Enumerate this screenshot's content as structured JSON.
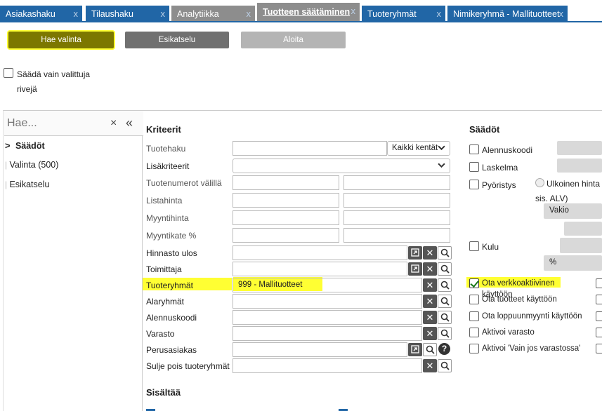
{
  "tabs": [
    {
      "label": "Asiakashaku",
      "close": "x"
    },
    {
      "label": "Tilaushaku",
      "close": "x"
    },
    {
      "label": "Analytiikka",
      "close": "x"
    },
    {
      "label": "Tuotteen säätäminen",
      "close": "x"
    },
    {
      "label": "Tuoteryhmät",
      "close": "x"
    },
    {
      "label": "Nimikeryhmä - Mallituotteet",
      "close": "x"
    }
  ],
  "toolbar": {
    "hae_label": "Hae valinta",
    "esikatselu_label": "Esikatselu",
    "aloita_label": "Aloita"
  },
  "adjust_selected_only": {
    "label_line1": "Säädä vain valittuja",
    "label_line2": "rivejä"
  },
  "sidebar": {
    "search_placeholder": "Hae...",
    "clear_icon": "×",
    "collapse_icon": "«",
    "items": [
      {
        "label": "Säädöt",
        "active": true,
        "marker": ">"
      },
      {
        "label": "Valinta (500)",
        "marker": "|"
      },
      {
        "label": "Esikatselu",
        "marker": "|"
      }
    ]
  },
  "criteria": {
    "title": "Kriteerit",
    "rows": [
      {
        "label": "Tuotehaku",
        "dropdown": "Kaikki kentät"
      },
      {
        "label": "Lisäkriteerit"
      },
      {
        "label": "Tuotenumerot välillä"
      },
      {
        "label": "Listahinta"
      },
      {
        "label": "Myyntihinta"
      },
      {
        "label": "Myyntikate %"
      },
      {
        "label": "Hinnasto ulos"
      },
      {
        "label": "Toimittaja"
      },
      {
        "label": "Tuoteryhmät",
        "value": "999 - Mallituotteet"
      },
      {
        "label": "Alaryhmät"
      },
      {
        "label": "Alennuskoodi"
      },
      {
        "label": "Varasto"
      },
      {
        "label": "Perusasiakas"
      },
      {
        "label": "Sulje pois tuoteryhmät"
      }
    ]
  },
  "contains": {
    "title": "Sisältää"
  },
  "adjustments": {
    "title": "Säädöt",
    "alennuskoodi": "Alennuskoodi",
    "laskelma": "Laskelma",
    "pyoristys": "Pyöristys",
    "ulkoinen_hinta": "Ulkoinen hinta (e",
    "sis_alv": "sis. ALV)",
    "vakio": "Vakio",
    "kulu": "Kulu",
    "percent": "%",
    "checks": [
      {
        "label": "Ota verkkoaktiivinen",
        "checked": true
      },
      {
        "label": "Ota tuotteet käyttöön",
        "checked": false
      },
      {
        "label": "Ota loppuunmyynti käyttöön",
        "checked": false
      },
      {
        "label": "Aktivoi varasto",
        "checked": false
      },
      {
        "label": "Aktivoi 'Vain jos varastossa'",
        "checked": false
      }
    ],
    "overlap_text": "käyttöön"
  },
  "colors": {
    "tab_blue": "#2166a6",
    "tab_grey": "#8d8d8d",
    "highlight": "#ffff33",
    "hae_button": "#7c7700"
  }
}
